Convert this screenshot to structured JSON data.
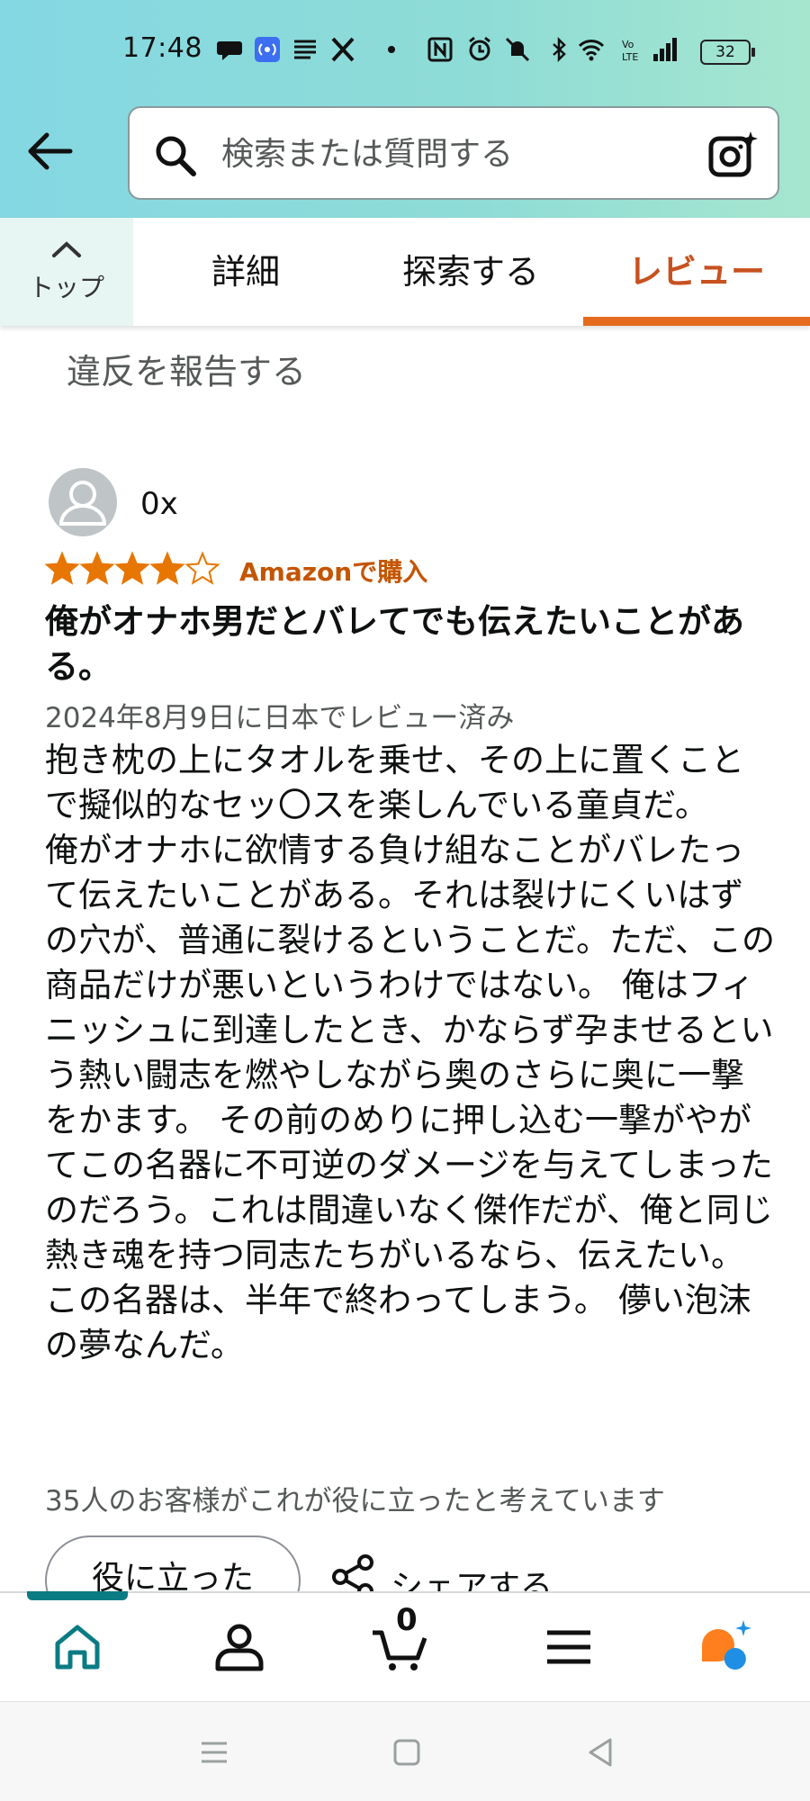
{
  "status_bar": {
    "time": "17:48",
    "battery": "32",
    "icons": [
      "chat-bubble-icon",
      "broadcast-icon",
      "news-icon",
      "x-logo-icon",
      "dot-icon",
      "nfc-icon",
      "alarm-icon",
      "mute-icon",
      "bluetooth-icon",
      "wifi-icon",
      "volte-icon",
      "signal-icon",
      "battery-icon"
    ]
  },
  "search": {
    "placeholder": "検索または質問する"
  },
  "tabs": {
    "top_label": "トップ",
    "items": [
      {
        "label": "詳細"
      },
      {
        "label": "探索する"
      },
      {
        "label": "レビュー"
      }
    ],
    "active_index": 2
  },
  "report": {
    "label": "違反を報告する"
  },
  "review": {
    "reviewer": "0x",
    "rating": 4,
    "rating_max": 5,
    "verified_label": "Amazonで購入",
    "title": "俺がオナホ男だとバレてでも伝えたいことがある。",
    "date": "2024年8月9日に日本でレビュー済み",
    "body": "抱き枕の上にタオルを乗せ、その上に置くことで擬似的なセッ〇スを楽しんでいる童貞だ。\n俺がオナホに欲情する負け組なことがバレたって伝えたいことがある。それは裂けにくいはずの穴が、普通に裂けるということだ。ただ、この商品だけが悪いというわけではない。 俺はフィニッシュに到達したとき、かならず孕ませるという熱い闘志を燃やしながら奥のさらに奥に一撃をかます。 その前のめりに押し込む一撃がやがてこの名器に不可逆のダメージを与えてしまったのだろう。これは間違いなく傑作だが、俺と同じ熱き魂を持つ同志たちがいるなら、伝えたい。 この名器は、半年で終わってしまう。 儚い泡沫の夢なんだ。",
    "helpful_count": "35人のお客様がこれが役に立ったと考えています",
    "helpful_button": "役に立った",
    "share_label": "シェアする"
  },
  "bottom_nav": {
    "items": [
      "home-icon",
      "account-icon",
      "cart-icon",
      "menu-icon",
      "rufus-ai-icon"
    ],
    "cart_count": "0",
    "active_index": 0
  },
  "colors": {
    "accent_orange": "#c7511f",
    "tab_indicator": "#e66b1f",
    "star": "#e77600",
    "teal": "#0a7b83",
    "ai_blue": "#1f8fe5"
  }
}
